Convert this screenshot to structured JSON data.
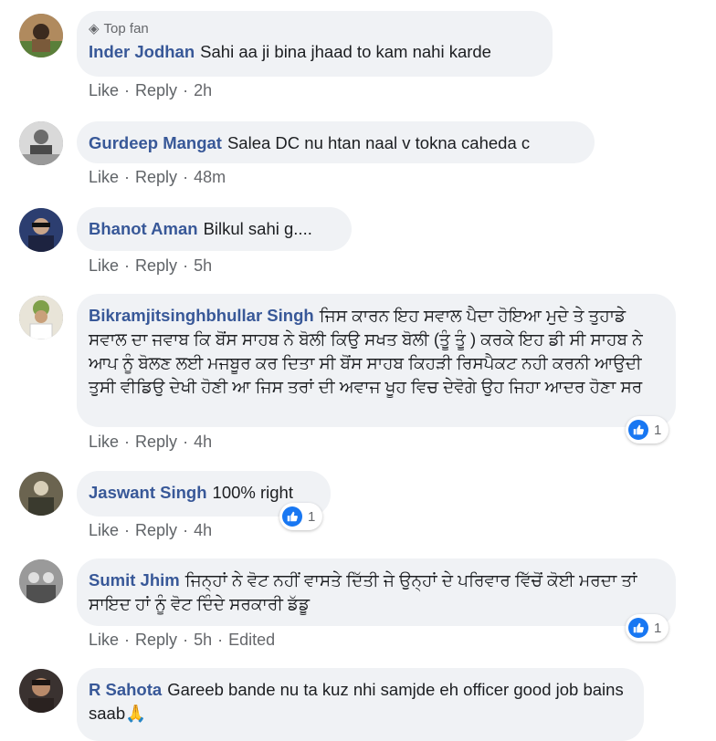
{
  "comments": [
    {
      "badge": "Top fan",
      "name": "Inder Jodhan",
      "text": "Sahi aa ji bina jhaad to kam nahi karde",
      "like": "Like",
      "reply": "Reply",
      "time": "2h"
    },
    {
      "name": "Gurdeep Mangat",
      "text": "Salea DC nu htan naal v tokna caheda c",
      "like": "Like",
      "reply": "Reply",
      "time": "48m"
    },
    {
      "name": "Bhanot Aman",
      "text": "Bilkul sahi g....",
      "like": "Like",
      "reply": "Reply",
      "time": "5h"
    },
    {
      "name": "Bikramjitsinghbhullar Singh",
      "text": "ਜਿਸ ਕਾਰਨ ਇਹ ਸਵਾਲ ਪੈਦਾ ਹੋਇਆ ਮੁਦੇ ਤੇ ਤੁਹਾਡੇ ਸਵਾਲ ਦਾ ਜਵਾਬ ਕਿ ਬੋਂਸ ਸਾਹਬ ਨੇ ਬੋਲੀ ਕਿਉ ਸਖਤ ਬੋਲੀ (ਤੂੰ ਤੂੰ ) ਕਰਕੇ ਇਹ ਡੀ ਸੀ ਸਾਹਬ ਨੇ ਆਪ ਨੂੰ ਬੋਲਣ ਲਈ ਮਜਬੂਰ ਕਰ ਦਿਤਾ ਸੀ ਬੋਂਸ ਸਾਹਬ ਕਿਹੜੀ ਰਿਸਪੈਕਟ ਨਹੀ ਕਰਨੀ ਆਉਦੀ ਤੁਸੀ ਵੀਡਿਉ ਦੇਖੀ ਹੋਣੀ ਆ ਜਿਸ ਤਰਾਂ ਦੀ ਅਵਾਜ ਖੂਹ ਵਿਚ ਦੇਵੋਗੇ ਉਹ ਜਿਹਾ ਆਦਰ ਹੋਣਾ ਸਰ",
      "like": "Like",
      "reply": "Reply",
      "time": "4h",
      "reactions": "1"
    },
    {
      "name": "Jaswant Singh",
      "text": "100% right",
      "like": "Like",
      "reply": "Reply",
      "time": "4h",
      "reactions": "1"
    },
    {
      "name": "Sumit Jhim",
      "text": "ਜਿਨ੍ਹਾਂ ਨੇ ਵੋਟ ਨਹੀਂ ਵਾਸਤੇ ਦਿੱਤੀ ਜੇ ਉਨ੍ਹਾਂ ਦੇ ਪਰਿਵਾਰ ਵਿੱਚੋਂ ਕੋਈ ਮਰਦਾ ਤਾਂ ਸਾਇਦ ਹਾਂ ਨੂੰ ਵੋਟ ਦਿੰਦੇ ਸਰਕਾਰੀ ਡੱਡੂ",
      "like": "Like",
      "reply": "Reply",
      "time": "5h",
      "edited": "Edited",
      "reactions": "1"
    },
    {
      "name": "R Sahota",
      "text": "Gareeb bande nu ta kuz nhi samjde eh officer good job bains saab🙏"
    }
  ],
  "colors": {
    "name": "#385898",
    "bubble": "#f0f2f5",
    "meta": "#65676b",
    "like_blue": "#1877f2"
  }
}
